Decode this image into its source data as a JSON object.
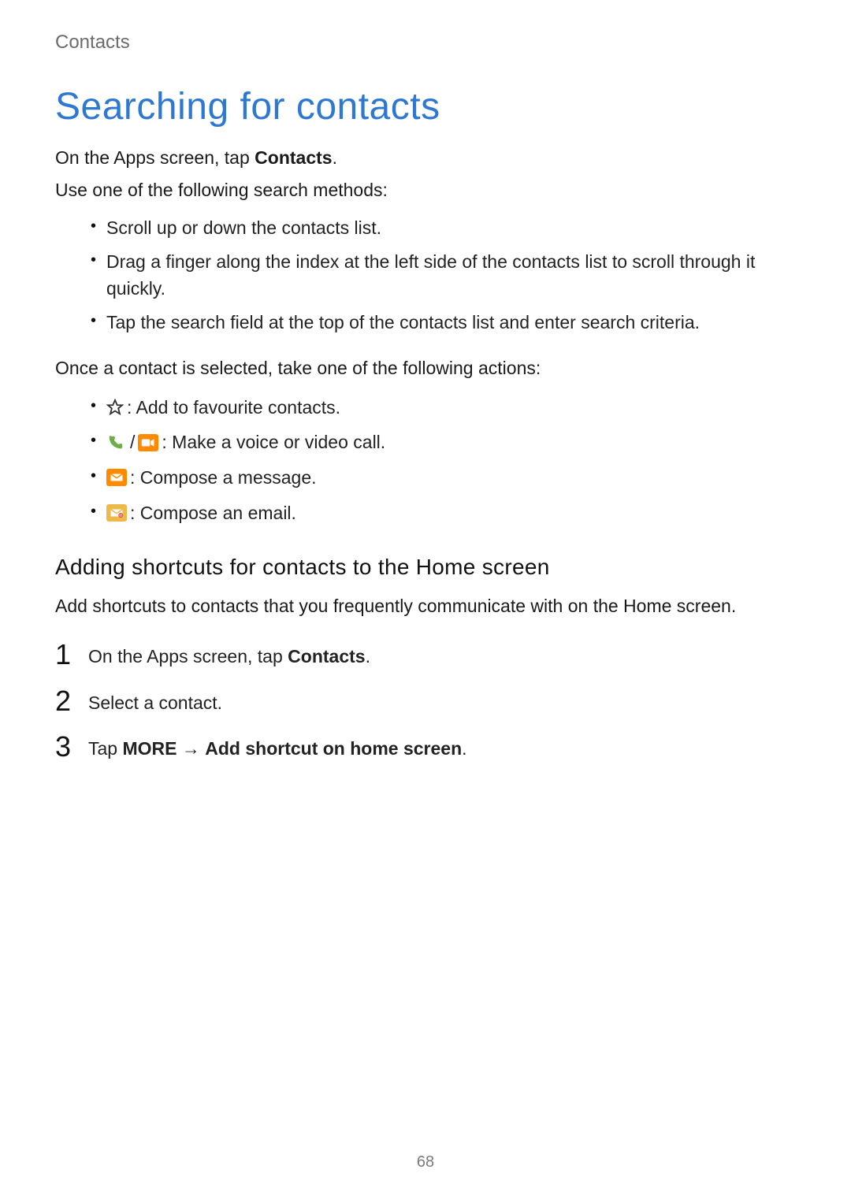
{
  "breadcrumb": "Contacts",
  "title": "Searching for contacts",
  "intro": {
    "line1_prefix": "On the Apps screen, tap ",
    "line1_app": "Contacts",
    "line1_suffix": ".",
    "line2": "Use one of the following search methods:"
  },
  "search_methods": [
    "Scroll up or down the contacts list.",
    "Drag a finger along the index at the left side of the contacts list to scroll through it quickly.",
    "Tap the search field at the top of the contacts list and enter search criteria."
  ],
  "once_selected_intro": "Once a contact is selected, take one of the following actions:",
  "actions": {
    "favourite": " : Add to favourite contacts.",
    "call_sep": " / ",
    "call": " : Make a voice or video call.",
    "message": " : Compose a message.",
    "email": " : Compose an email."
  },
  "subhead": "Adding shortcuts for contacts to the Home screen",
  "subhead_text": "Add shortcuts to contacts that you frequently communicate with on the Home screen.",
  "steps": {
    "s1_prefix": "On the Apps screen, tap ",
    "s1_app": "Contacts",
    "s1_suffix": ".",
    "s2": "Select a contact.",
    "s3_prefix": "Tap ",
    "s3_more": "MORE",
    "s3_arrow": " → ",
    "s3_rest": "Add shortcut on home screen",
    "s3_suffix": "."
  },
  "page_number": "68"
}
